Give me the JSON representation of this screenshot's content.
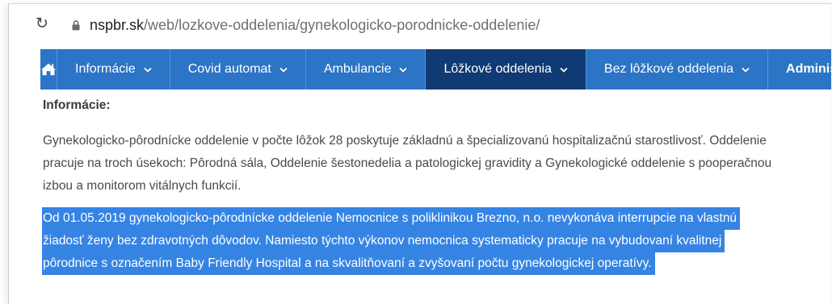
{
  "browser": {
    "reload_icon": "reload-icon",
    "lock_icon": "lock-icon",
    "url_domain": "nspbr.sk",
    "url_path": "/web/lozkove-oddelenia/gynekologicko-porodnicke-oddelenie/"
  },
  "nav": {
    "home_icon": "home-icon",
    "items": [
      {
        "label": "Informácie",
        "has_dropdown": true,
        "active": false
      },
      {
        "label": "Covid automat",
        "has_dropdown": true,
        "active": false
      },
      {
        "label": "Ambulancie",
        "has_dropdown": true,
        "active": false
      },
      {
        "label": "Lôžkové oddelenia",
        "has_dropdown": true,
        "active": true
      },
      {
        "label": "Bez lôžkové oddelenia",
        "has_dropdown": true,
        "active": false
      },
      {
        "label": "Administ",
        "has_dropdown": false,
        "active": false
      }
    ]
  },
  "content": {
    "section_title": "Informácie:",
    "paragraph_lines": [
      "Gynekologicko-pôrodnícke oddelenie v počte lôžok 28 poskytuje základnú a špecializovanú hospitalizačnú starostlivosť. Oddelenie",
      "pracuje na troch úsekoch: Pôrodná sála, Oddelenie šestonedelia a patologickej gravidity a Gynekologické oddelenie s pooperačnou",
      "izbou a monitorom vitálnych funkcií."
    ],
    "selected_lines": [
      "Od 01.05.2019 gynekologicko-pôrodnícke oddelenie Nemocnice s poliklinikou Brezno, n.o. nevykonáva interrupcie na vlastnú",
      "žiadosť ženy bez zdravotných dôvodov. Namiesto týchto výkonov nemocnica systematicky pracuje na vybudovaní kvalitnej",
      "pôrodnice s označením Baby Friendly Hospital a na skvalitňovaní a zvyšovaní počtu gynekologickej operatívy."
    ],
    "selection_color": "#3584e4"
  },
  "colors": {
    "nav_bg": "#2b74c6",
    "nav_active_bg": "#0f3a73"
  }
}
